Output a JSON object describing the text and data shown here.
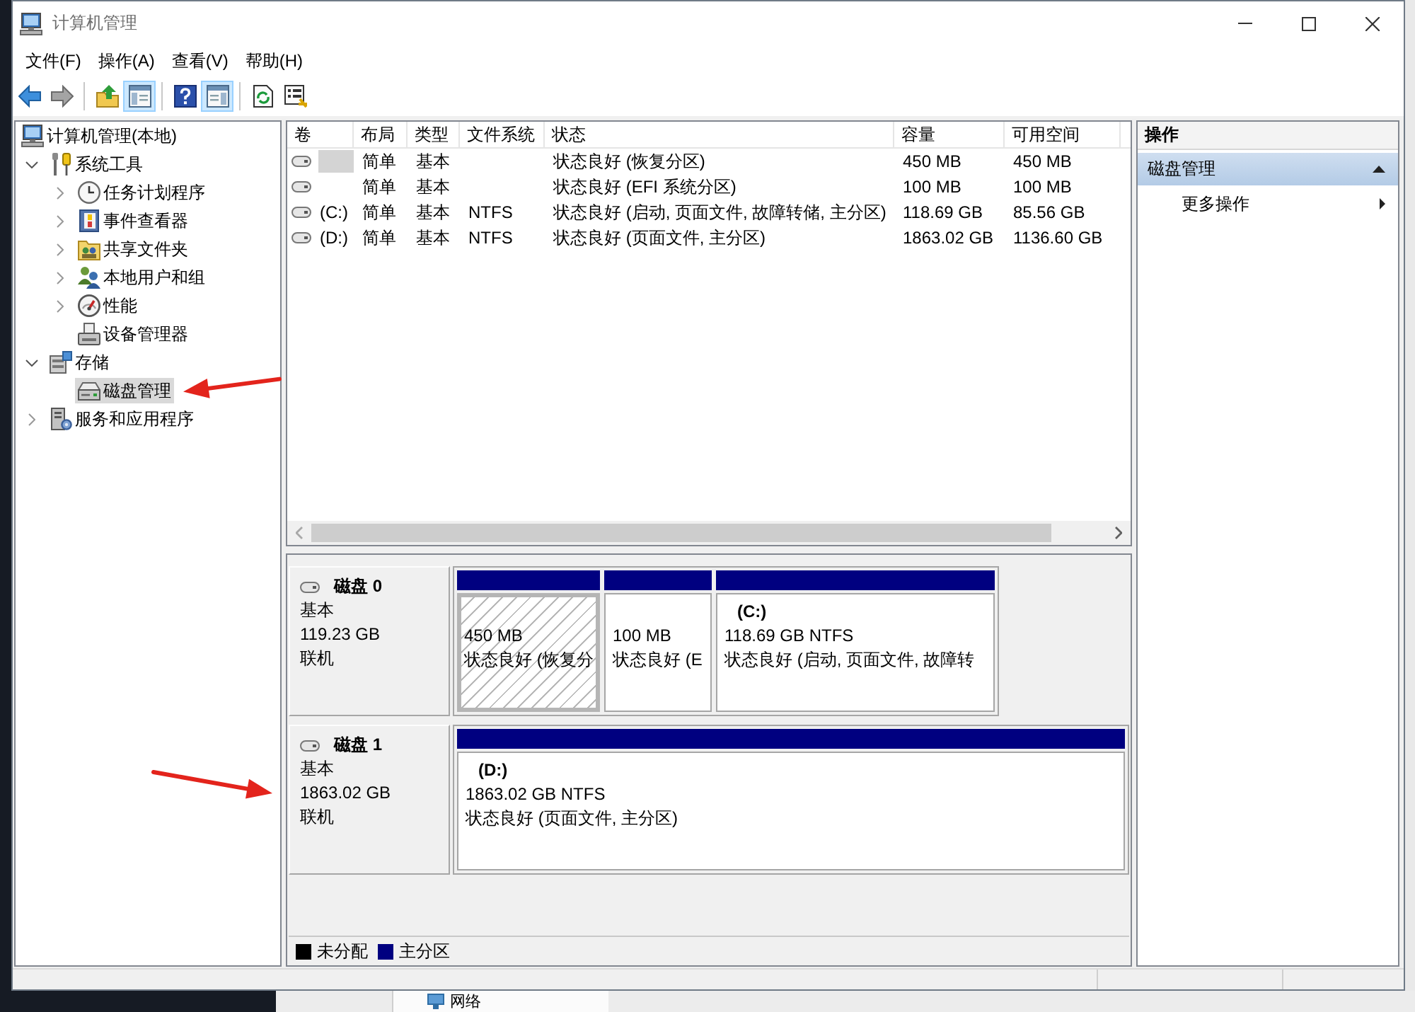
{
  "window": {
    "title": "计算机管理"
  },
  "menu_bar": [
    {
      "label": "文件(F)"
    },
    {
      "label": "操作(A)"
    },
    {
      "label": "查看(V)"
    },
    {
      "label": "帮助(H)"
    }
  ],
  "toolbar": {
    "groups": [
      [
        {
          "kind": "back",
          "disabled": false,
          "on": false
        },
        {
          "kind": "forward",
          "disabled": true,
          "on": false
        }
      ],
      [
        {
          "kind": "up",
          "disabled": false,
          "on": false
        },
        {
          "kind": "console-tree",
          "disabled": false,
          "on": true
        }
      ],
      [
        {
          "kind": "help",
          "disabled": false,
          "on": false
        },
        {
          "kind": "action-pane",
          "disabled": false,
          "on": true
        }
      ],
      [
        {
          "kind": "refresh",
          "disabled": false,
          "on": false
        },
        {
          "kind": "export",
          "disabled": false,
          "on": false
        }
      ]
    ]
  },
  "tree": [
    {
      "label": "计算机管理(本地)",
      "kind": "computer",
      "selected": false,
      "children": [
        {
          "label": "系统工具",
          "kind": "tools",
          "expanded": true,
          "selected": false,
          "children": [
            {
              "label": "任务计划程序",
              "kind": "scheduler",
              "expanded": false,
              "selected": false
            },
            {
              "label": "事件查看器",
              "kind": "event-log",
              "expanded": false,
              "selected": false
            },
            {
              "label": "共享文件夹",
              "kind": "shared-folder",
              "expanded": false,
              "selected": false
            },
            {
              "label": "本地用户和组",
              "kind": "users",
              "expanded": false,
              "selected": false
            },
            {
              "label": "性能",
              "kind": "performance",
              "expanded": false,
              "selected": false
            },
            {
              "label": "设备管理器",
              "kind": "devices",
              "selected": false
            }
          ]
        },
        {
          "label": "存储",
          "kind": "storage",
          "expanded": true,
          "selected": false,
          "children": [
            {
              "label": "磁盘管理",
              "kind": "disk",
              "selected": true
            }
          ]
        },
        {
          "label": "服务和应用程序",
          "kind": "services",
          "expanded": false,
          "selected": false
        }
      ]
    }
  ],
  "volume_table": {
    "columns": [
      "卷",
      "布局",
      "类型",
      "文件系统",
      "状态",
      "容量",
      "可用空间"
    ],
    "rows": [
      {
        "layout": "简单",
        "type": "基本",
        "status": "状态良好 (恢复分区)",
        "capacity": "450 MB",
        "free_space": "450 MB",
        "selected": true
      },
      {
        "layout": "简单",
        "type": "基本",
        "status": "状态良好 (EFI 系统分区)",
        "capacity": "100 MB",
        "free_space": "100 MB",
        "selected": false
      },
      {
        "volume": "(C:)",
        "layout": "简单",
        "type": "基本",
        "file_system": "NTFS",
        "status": "状态良好 (启动, 页面文件, 故障转储, 主分区)",
        "capacity": "118.69 GB",
        "free_space": "85.56 GB",
        "selected": false
      },
      {
        "volume": "(D:)",
        "layout": "简单",
        "type": "基本",
        "file_system": "NTFS",
        "status": "状态良好 (页面文件, 主分区)",
        "capacity": "1863.02 GB",
        "free_space": "1136.60 GB",
        "selected": false
      }
    ]
  },
  "disks": [
    {
      "name": "磁盘 0",
      "type": "基本",
      "size": "119.23 GB",
      "status": "联机",
      "partitions": [
        {
          "size": "450 MB",
          "status": "状态良好 (恢复分",
          "selected": true
        },
        {
          "size": "100 MB",
          "status": "状态良好 (E",
          "selected": false
        },
        {
          "label": "(C:)",
          "size": "118.69 GB NTFS",
          "status": "状态良好 (启动, 页面文件, 故障转",
          "selected": false
        }
      ]
    },
    {
      "name": "磁盘 1",
      "type": "基本",
      "size": "1863.02 GB",
      "status": "联机",
      "partitions": [
        {
          "label": "(D:)",
          "size": "1863.02 GB NTFS",
          "status": "状态良好 (页面文件, 主分区)",
          "selected": false
        }
      ]
    }
  ],
  "legend": [
    {
      "label": "未分配",
      "color": "#000000"
    },
    {
      "label": "主分区",
      "color": "#000080"
    }
  ],
  "actions": {
    "title": "操作",
    "sections": [
      {
        "title": "磁盘管理",
        "expanded": true,
        "items": [
          {
            "label": "更多操作",
            "submenu": true
          }
        ]
      }
    ]
  },
  "background": {
    "label": "网络"
  }
}
